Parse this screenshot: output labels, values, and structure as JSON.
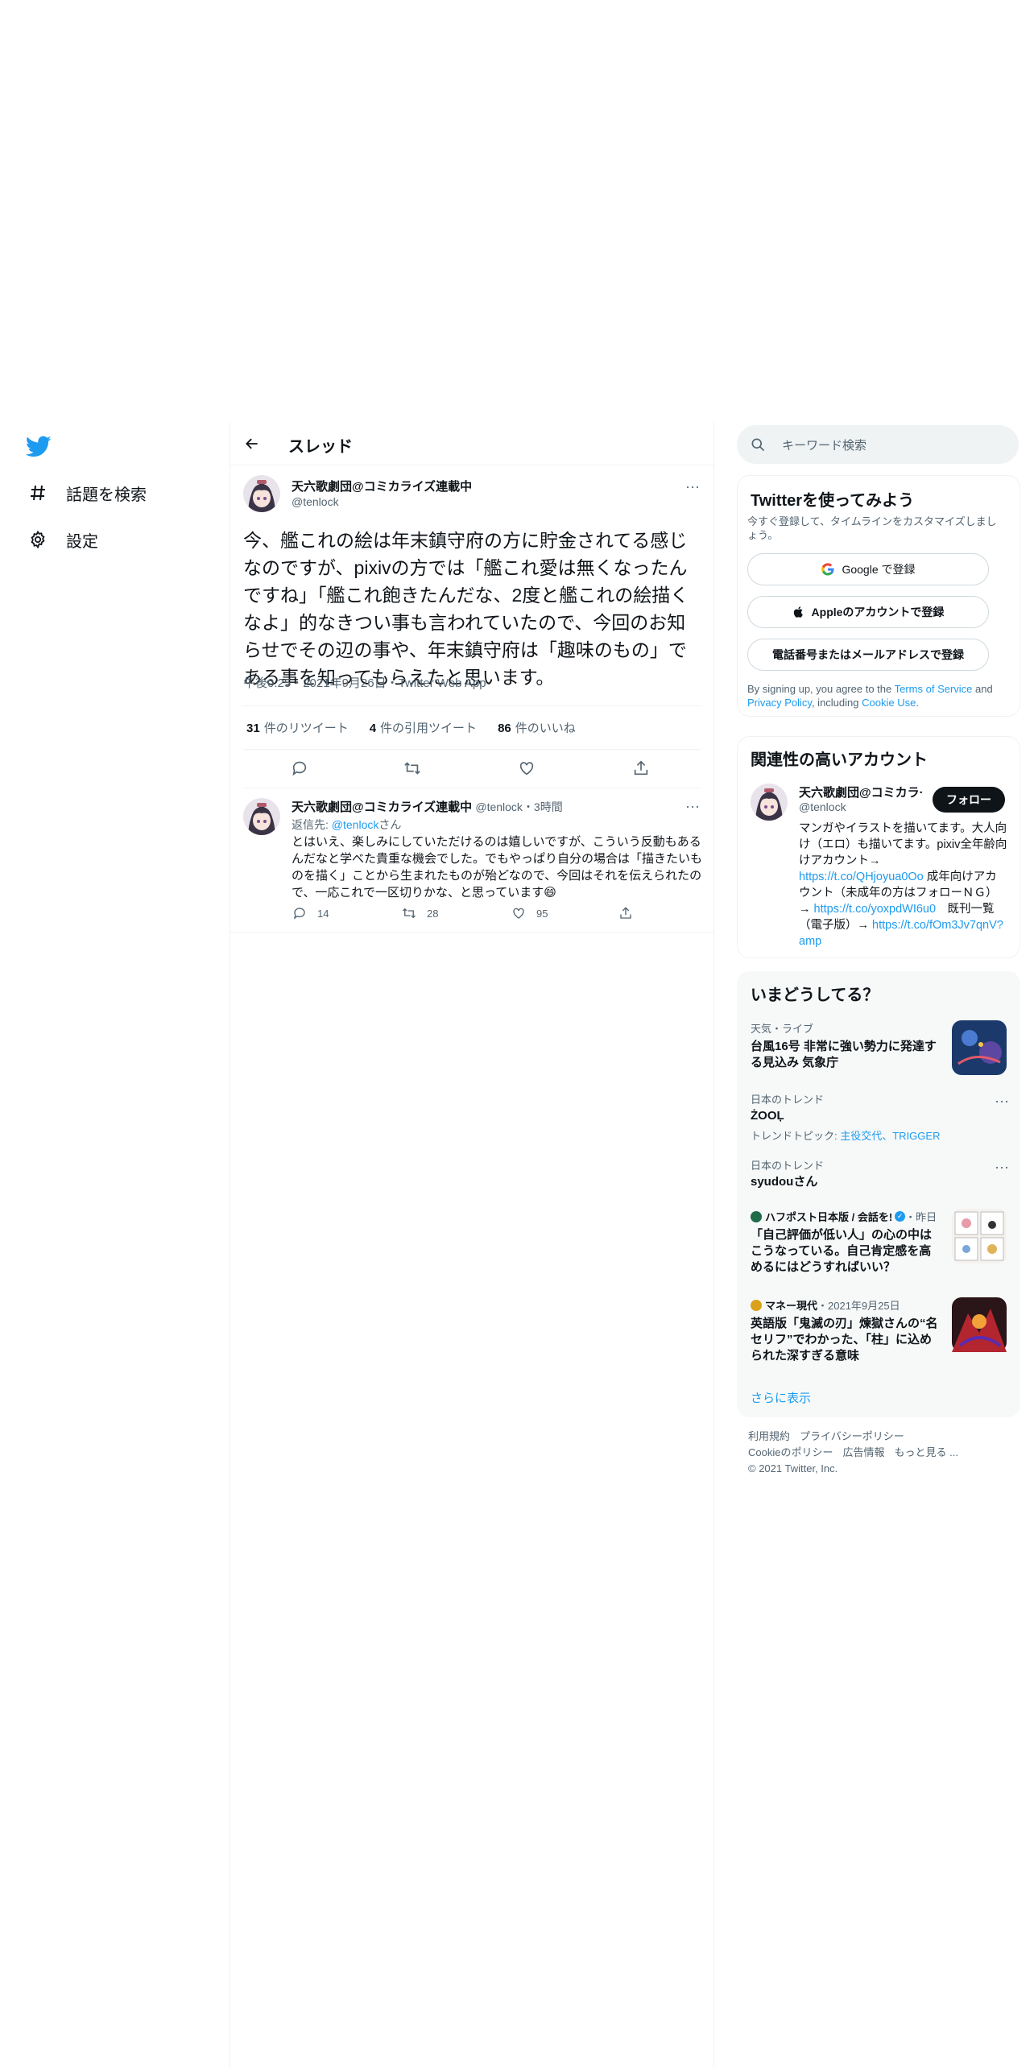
{
  "nav": {
    "items": [
      {
        "label": "話題を検索",
        "icon": "hashtag-icon"
      },
      {
        "label": "設定",
        "icon": "gear-icon"
      }
    ]
  },
  "header": {
    "title": "スレッド"
  },
  "tweet": {
    "name": "天六歌劇団@コミカライズ連載中",
    "handle": "@tenlock",
    "text": "今、艦これの絵は年末鎮守府の方に貯金されてる感じなのですが、pixivの方では「艦これ愛は無くなったんですね」「艦これ飽きたんだな、2度と艦これの絵描くなよ」的なきつい事も言われていたので、今回のお知らせでその辺の事や、年末鎮守府は「趣味のもの」である事を知ってもらえたと思います。",
    "meta": "午後0:25・2021年9月26日・Twitter Web App",
    "retweets": {
      "count": "31",
      "label": "件のリツイート"
    },
    "quotes": {
      "count": "4",
      "label": "件の引用ツイート"
    },
    "likes": {
      "count": "86",
      "label": "件のいいね"
    }
  },
  "reply": {
    "name": "天六歌劇団@コミカライズ連載中",
    "handle": "@tenlock",
    "time": "・3時間",
    "replying_prefix": "返信先: ",
    "replying_to": "@tenlock",
    "replying_suffix": "さん",
    "text": "とはいえ、楽しみにしていただけるのは嬉しいですが、こういう反動もあるんだなと学べた貴重な機会でした。でもやっぱり自分の場合は「描きたいものを描く」ことから生まれたものが殆どなので、今回はそれを伝えられたので、一応これで一区切りかな、と思っています😄",
    "replies": "14",
    "retweets": "28",
    "likes": "95"
  },
  "search": {
    "placeholder": "キーワード検索"
  },
  "signup": {
    "title": "Twitterを使ってみよう",
    "subtitle": "今すぐ登録して、タイムラインをカスタマイズしましょう。",
    "google": "Google で登録",
    "apple": "Appleのアカウントで登録",
    "phone": "電話番号またはメールアドレスで登録",
    "terms_1": "By signing up, you agree to the ",
    "terms_link1": "Terms of Service",
    "terms_2": " and ",
    "terms_link2": "Privacy Policy",
    "terms_3": ", including ",
    "terms_link3": "Cookie Use",
    "terms_4": "."
  },
  "related": {
    "title": "関連性の高いアカウント",
    "name": "天六歌劇団@コミカラ·",
    "handle": "@tenlock",
    "follow": "フォロー",
    "bio_1": "マンガやイラストを描いてます。大人向け（エロ）も描いてます。pixiv全年齢向けアカウント→ ",
    "bio_link1": "https://t.co/QHjoyua0Oo",
    "bio_2": " 成年向けアカウント（未成年の方はフォローＮＧ）→ ",
    "bio_link2": "https://t.co/yoxpdWI6u0",
    "bio_3": "　既刊一覧（電子版）→ ",
    "bio_link3": "https://t.co/fOm3Jv7qnV?amp"
  },
  "trends": {
    "title": "いまどうしてる？",
    "items": [
      {
        "category": "天気・ライブ",
        "title": "台風16号 非常に強い勢力に発達する見込み 気象庁"
      },
      {
        "category": "日本のトレンド",
        "title": "ŻOOĻ",
        "sub_prefix": "トレンドトピック: ",
        "sub_links": "主役交代、TRIGGER"
      },
      {
        "category": "日本のトレンド",
        "title": "syudouさん"
      },
      {
        "source": "ハフポスト日本版 / 会話を!",
        "time": "・昨日",
        "title": "「自己評価が低い人」の心の中はこうなっている。自己肯定感を高めるにはどうすればいい？"
      },
      {
        "source": "マネー現代",
        "time": "・2021年9月25日",
        "title": "英語版「鬼滅の刃」煉獄さんの“名セリフ”でわかった、「柱」に込められた深すぎる意味"
      }
    ],
    "show_more": "さらに表示"
  },
  "footer": {
    "links1": [
      "利用規約",
      "プライバシーポリシー"
    ],
    "links2": [
      "Cookieのポリシー",
      "広告情報",
      "もっと見る ..."
    ],
    "copyright": "© 2021 Twitter, Inc."
  },
  "colors": {
    "accent": "#1d9bf0",
    "text": "#0f1419",
    "muted": "#536471",
    "border": "#eff3f4"
  }
}
